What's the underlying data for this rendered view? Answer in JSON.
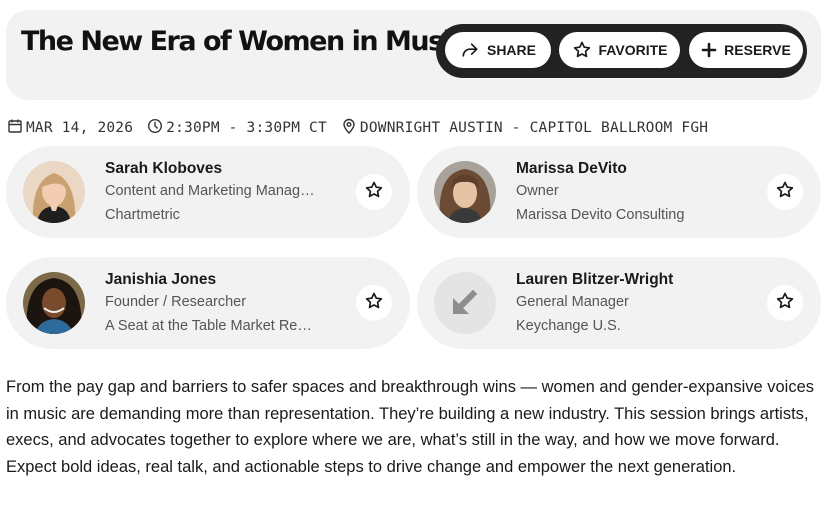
{
  "event": {
    "title": "The New Era of Women in Music",
    "actions": {
      "share_label": "SHARE",
      "favorite_label": "FAVORITE",
      "reserve_label": "RESERVE"
    },
    "date": "MAR 14, 2026",
    "time": "2:30PM - 3:30PM CT",
    "location": "DOWNRIGHT AUSTIN - CAPITOL BALLROOM FGH"
  },
  "speakers": [
    {
      "name": "Sarah Kloboves",
      "role": "Content and Marketing Manag…",
      "org": "Chartmetric",
      "avatar": "photo"
    },
    {
      "name": "Marissa DeVito",
      "role": "Owner",
      "org": "Marissa Devito Consulting",
      "avatar": "photo"
    },
    {
      "name": "Janishia Jones",
      "role": "Founder / Researcher",
      "org": "A Seat at the Table Market Re…",
      "avatar": "photo"
    },
    {
      "name": "Lauren Blitzer-Wright",
      "role": "General Manager",
      "org": "Keychange U.S.",
      "avatar": "placeholder-arrow-icon"
    }
  ],
  "description": "From the pay gap and barriers to safer spaces and breakthrough wins — women and gender-expansive voices in music are demanding more than representation. They’re building a new industry. This session brings artists, execs, and advocates together to explore where we are, what’s still in the way, and how we move forward. Expect bold ideas, real talk, and actionable steps to drive change and empower the next generation.",
  "colors": {
    "panel_bg": "#f2f2f2",
    "action_bar_bg": "#222222",
    "text_primary": "#1a1a1a",
    "text_secondary": "#555555"
  }
}
